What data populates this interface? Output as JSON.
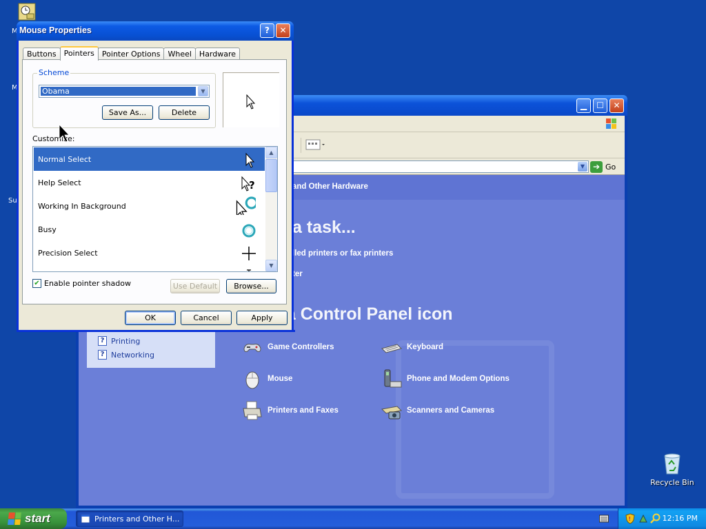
{
  "desktop": {
    "icons": [
      {
        "label": "Recycle Bin",
        "icon": "recycle-bin-icon"
      }
    ],
    "top_left_icon": "scheduled-tasks-icon",
    "edge_fragments": [
      "M",
      "M",
      "Su"
    ]
  },
  "control_panel": {
    "title": "Printers and Other Hardware",
    "go_label": "Go",
    "heading_fragment": "and Other Hardware",
    "task_heading_fragment": "a task...",
    "tasks": [
      "lled printers or fax printers",
      "ter"
    ],
    "icon_heading_fragment": "k a Control Panel icon",
    "see_also": [
      {
        "label": "Printing"
      },
      {
        "label": "Networking"
      }
    ],
    "icons": [
      {
        "label": "Game Controllers",
        "icon": "game-controller-icon"
      },
      {
        "label": "Keyboard",
        "icon": "keyboard-icon"
      },
      {
        "label": "Mouse",
        "icon": "mouse-icon"
      },
      {
        "label": "Phone and Modem Options",
        "icon": "phone-modem-icon"
      },
      {
        "label": "Printers and Faxes",
        "icon": "printer-icon"
      },
      {
        "label": "Scanners and Cameras",
        "icon": "scanner-camera-icon"
      }
    ]
  },
  "dialog": {
    "title": "Mouse Properties",
    "help_label": "?",
    "close_label": "✕",
    "tabs": [
      {
        "label": "Buttons"
      },
      {
        "label": "Pointers",
        "active": true
      },
      {
        "label": "Pointer Options"
      },
      {
        "label": "Wheel"
      },
      {
        "label": "Hardware"
      }
    ],
    "scheme": {
      "legend": "Scheme",
      "selected": "Obama",
      "save_as_label": "Save As...",
      "delete_label": "Delete"
    },
    "customize_label": "Customize:",
    "cursors": [
      {
        "label": "Normal Select",
        "icon": "arrow-cursor-icon",
        "selected": true
      },
      {
        "label": "Help Select",
        "icon": "help-cursor-icon"
      },
      {
        "label": "Working In Background",
        "icon": "working-cursor-icon"
      },
      {
        "label": "Busy",
        "icon": "busy-cursor-icon"
      },
      {
        "label": "Precision Select",
        "icon": "crosshair-cursor-icon"
      }
    ],
    "enable_shadow_label": "Enable pointer shadow",
    "enable_shadow_checked": true,
    "use_default_label": "Use Default",
    "browse_label": "Browse...",
    "ok_label": "OK",
    "cancel_label": "Cancel",
    "apply_label": "Apply"
  },
  "taskbar": {
    "start_label": "start",
    "task_label": "Printers and Other H...",
    "clock": "12:16 PM"
  }
}
